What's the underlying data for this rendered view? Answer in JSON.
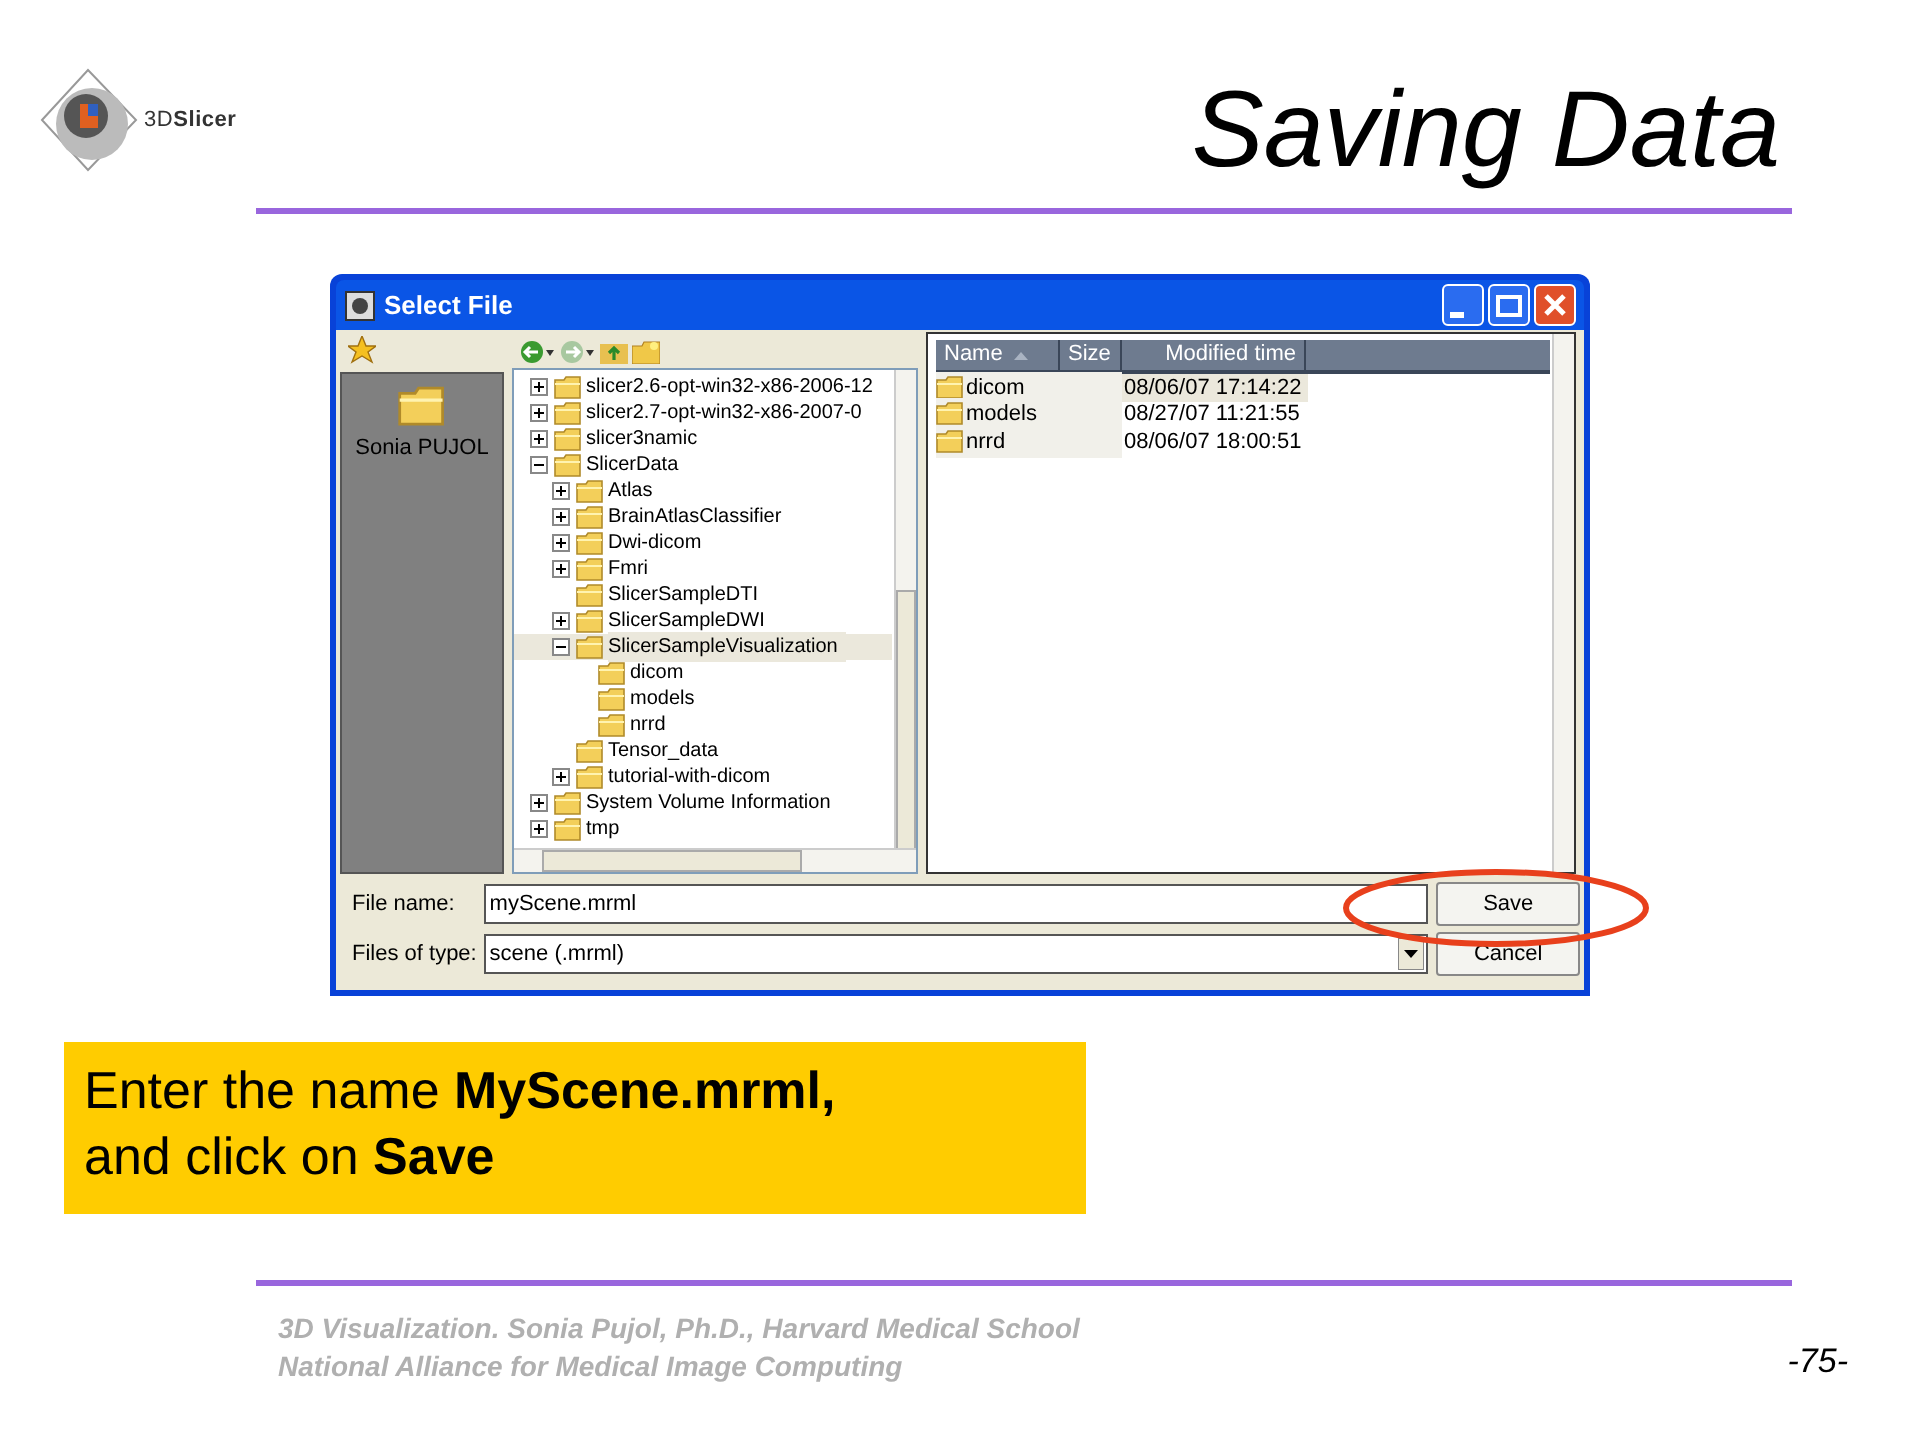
{
  "logo": {
    "text": "3D**Slicer**"
  },
  "title": "Saving Data",
  "dialog": {
    "title": "Select File",
    "places": [
      {
        "label": "Sonia PUJOL"
      }
    ],
    "tree": [
      {
        "label": "slicer2.6-opt-win32-x86-2006-12",
        "expanded": false,
        "selected": false
      },
      {
        "label": "slicer2.7-opt-win32-x86-2007-0",
        "expanded": false,
        "selected": false
      },
      {
        "label": "slicer3namic",
        "expanded": false,
        "selected": false
      },
      {
        "label": "SlicerData",
        "expanded": true,
        "selected": false,
        "children": [
          {
            "label": "Atlas",
            "expanded": false,
            "selected": false
          },
          {
            "label": "BrainAtlasClassifier",
            "expanded": false,
            "selected": false
          },
          {
            "label": "Dwi-dicom",
            "expanded": false,
            "selected": false
          },
          {
            "label": "Fmri",
            "expanded": false,
            "selected": false
          },
          {
            "label": "SlicerSampleDTI",
            "selected": false
          },
          {
            "label": "SlicerSampleDWI",
            "expanded": false,
            "selected": false
          },
          {
            "label": "SlicerSampleVisualization",
            "expanded": true,
            "selected": true,
            "children": [
              {
                "label": "dicom",
                "selected": false
              },
              {
                "label": "models",
                "selected": false
              },
              {
                "label": "nrrd",
                "selected": false
              }
            ]
          },
          {
            "label": "Tensor_data",
            "selected": false
          },
          {
            "label": "tutorial-with-dicom",
            "expanded": false,
            "selected": false
          }
        ]
      },
      {
        "label": "System Volume Information",
        "expanded": false,
        "selected": false
      },
      {
        "label": "tmp",
        "expanded": false,
        "selected": false
      }
    ],
    "file_list": {
      "columns": [
        {
          "label": "Name",
          "sorted": true
        },
        {
          "label": "Size",
          "sorted": false
        },
        {
          "label": "Modified time",
          "sorted": false
        }
      ],
      "rows": [
        {
          "name": "dicom",
          "modified": "08/06/07 17:14:22",
          "selected": true
        },
        {
          "name": "models",
          "modified": "08/27/07 11:21:55",
          "selected": false
        },
        {
          "name": "nrrd",
          "modified": "08/06/07 18:00:51",
          "selected": false
        }
      ]
    },
    "file_name": {
      "label": "File name:",
      "value": "myScene.mrml"
    },
    "file_type": {
      "label": "Files of type:",
      "value": "scene (.mrml)"
    },
    "buttons": [
      "Save",
      "Cancel"
    ]
  },
  "callout": "Enter the name **MyScene.mrml,** and click on **Save**",
  "footer": {
    "lines": [
      "3D Visualization. Sonia Pujol, Ph.D., Harvard Medical School",
      "National Alliance for Medical Image Computing"
    ],
    "page": "-75-"
  }
}
